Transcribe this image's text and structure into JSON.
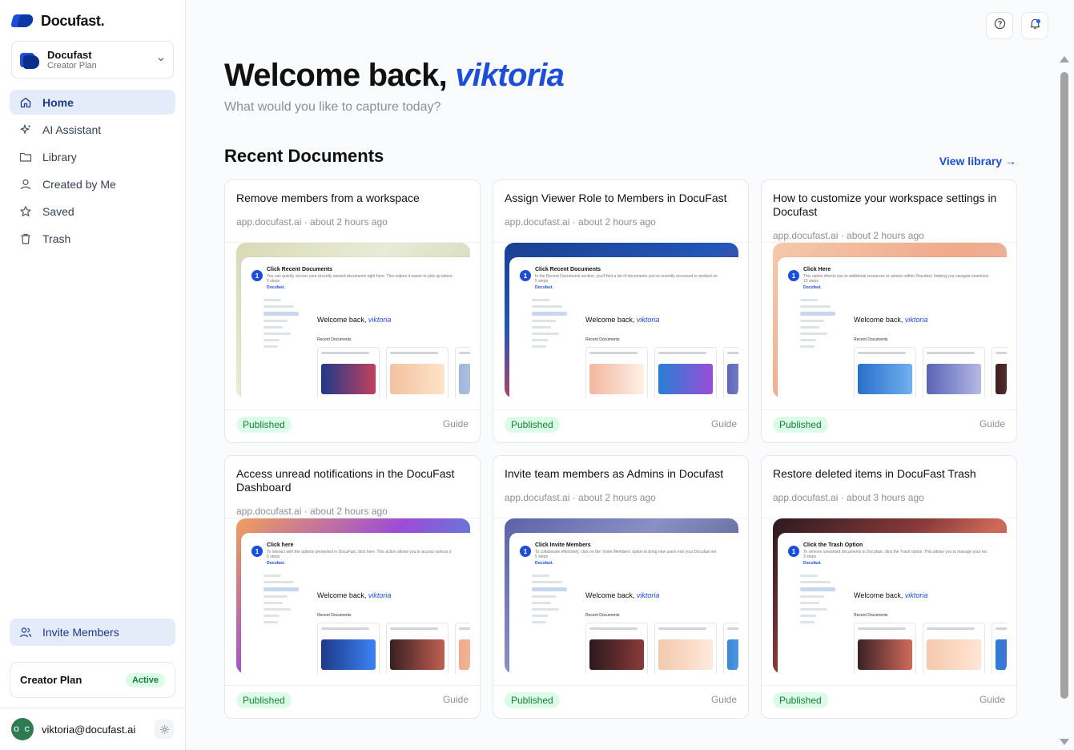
{
  "brand": {
    "name": "Docufast."
  },
  "workspace": {
    "name": "Docufast",
    "plan": "Creator Plan"
  },
  "nav": {
    "items": [
      {
        "label": "Home",
        "icon": "home-icon",
        "active": true
      },
      {
        "label": "AI Assistant",
        "icon": "sparkle-icon",
        "active": false
      },
      {
        "label": "Library",
        "icon": "folder-icon",
        "active": false
      },
      {
        "label": "Created by Me",
        "icon": "user-icon",
        "active": false
      },
      {
        "label": "Saved",
        "icon": "star-icon",
        "active": false
      },
      {
        "label": "Trash",
        "icon": "trash-icon",
        "active": false
      }
    ]
  },
  "invite": {
    "label": "Invite Members"
  },
  "plan_box": {
    "label": "Creator Plan",
    "status": "Active"
  },
  "user": {
    "email": "viktoria@docufast.ai",
    "initials": "O C"
  },
  "main": {
    "welcome_prefix": "Welcome back,",
    "username": "viktoria",
    "subtitle": "What would you like to capture today?",
    "section_title": "Recent Documents",
    "view_library": "View library →"
  },
  "documents": [
    {
      "title": "Remove members from a workspace",
      "meta": "app.docufast.ai · about 2 hours ago",
      "status": "Published",
      "type": "Guide",
      "thumb_step": "Click Recent Documents",
      "thumb_desc": "You can quickly access your recently viewed documents right here. This makes it easier to pick up where",
      "thumb_steps": "5 steps",
      "thumb_bg": "linear-gradient(135deg,#d8d9b5 0%,#e8ecd6 40%,#c3c8a7 100%)"
    },
    {
      "title": "Assign Viewer Role to Members in DocuFast",
      "meta": "app.docufast.ai · about 2 hours ago",
      "status": "Published",
      "type": "Guide",
      "thumb_step": "Click Recent Documents",
      "thumb_desc": "In the Recent Documents section, you'll find a list of documents you've recently accessed or worked on.",
      "thumb_steps": "5 steps",
      "thumb_bg": "linear-gradient(160deg,#1a3f8f 0%,#2256b8 35%,#c2415e 70%,#e07a5a 100%)"
    },
    {
      "title": "How to customize your workspace settings in Docufast",
      "meta": "app.docufast.ai · about 2 hours ago",
      "status": "Published",
      "type": "Guide",
      "thumb_step": "Click Here",
      "thumb_desc": "This option directs you to additional resources or actions within Docufast, helping you navigate seamless",
      "thumb_steps": "10 steps",
      "thumb_bg": "linear-gradient(135deg,#f6c9ac 0%,#f0a98a 50%,#e6c6b6 100%)"
    },
    {
      "title": "Access unread notifications in the DocuFast Dashboard",
      "meta": "app.docufast.ai · about 2 hours ago",
      "status": "Published",
      "type": "Guide",
      "thumb_step": "Click here",
      "thumb_desc": "To interact with the options presented in DocuFast, click here. This action allows you to access various d",
      "thumb_steps": "6 steps",
      "thumb_bg": "linear-gradient(135deg,#f0a05a 0%,#9a4cd8 45%,#3a9fd8 80%,#2b84c9 100%)"
    },
    {
      "title": "Invite team members as Admins in Docufast",
      "meta": "app.docufast.ai · about 2 hours ago",
      "status": "Published",
      "type": "Guide",
      "thumb_step": "Click Invite Members",
      "thumb_desc": "To collaborate effectively, click on the 'Invite Members' option to bring new users into your Docufast wo",
      "thumb_steps": "5 steps",
      "thumb_bg": "linear-gradient(135deg,#5b63a8 0%,#8a90c4 40%,#3e4a78 100%)"
    },
    {
      "title": "Restore deleted items in DocuFast Trash",
      "meta": "app.docufast.ai · about 3 hours ago",
      "status": "Published",
      "type": "Guide",
      "thumb_step": "Click the Trash Option",
      "thumb_desc": "To remove unwanted documents in Docufast, click the Trash option. This allows you to manage your rec",
      "thumb_steps": "3 steps",
      "thumb_bg": "linear-gradient(135deg,#2b1a1f 0%,#8a3a3a 40%,#d06a5a 60%,#3a2226 100%)"
    }
  ],
  "thumb": {
    "brand": "Docufast.",
    "welcome_prefix": "Welcome back,",
    "username": "viktoria",
    "section": "Recent Documents"
  }
}
